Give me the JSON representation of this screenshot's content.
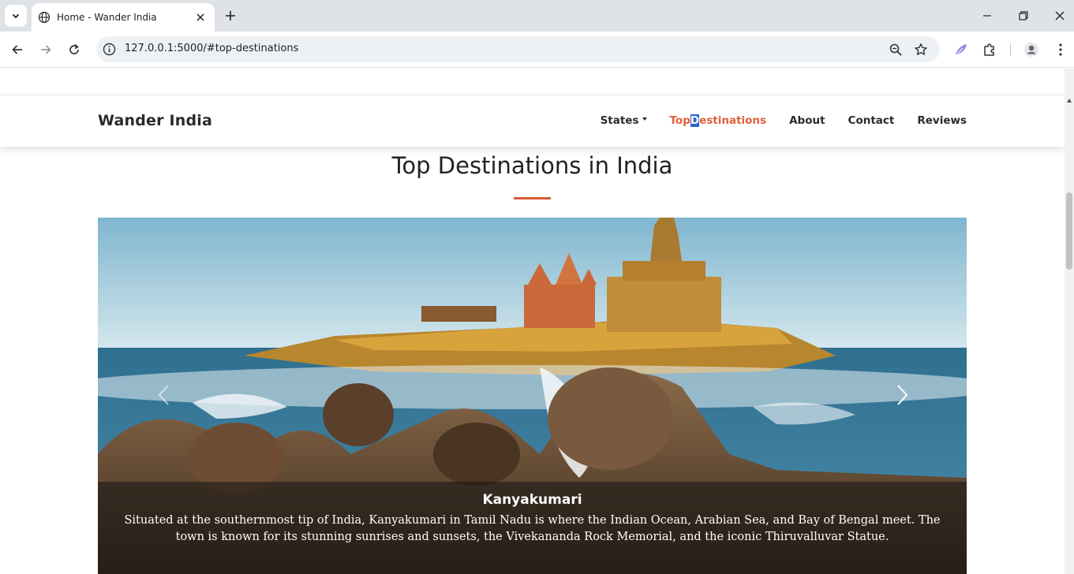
{
  "browser": {
    "tab_title": "Home - Wander India",
    "url": "127.0.0.1:5000/#top-destinations"
  },
  "site": {
    "brand": "Wander India",
    "nav": [
      {
        "label": "States"
      },
      {
        "label_pre": "Top",
        "label_hl": "D",
        "label_post": "estinations",
        "active": true
      },
      {
        "label": "About"
      },
      {
        "label": "Contact"
      },
      {
        "label": "Reviews"
      }
    ]
  },
  "section": {
    "title": "Top Destinations in India"
  },
  "carousel": {
    "slide_title": "Kanyakumari",
    "slide_text": "Situated at the southernmost tip of India, Kanyakumari in Tamil Nadu is where the Indian Ocean, Arabian Sea, and Bay of Bengal meet. The town is known for its stunning sunrises and sunsets, the Vivekananda Rock Memorial, and the iconic Thiruvalluvar Statue."
  },
  "colors": {
    "accent": "#e06039",
    "highlight": "#2c62d1"
  }
}
